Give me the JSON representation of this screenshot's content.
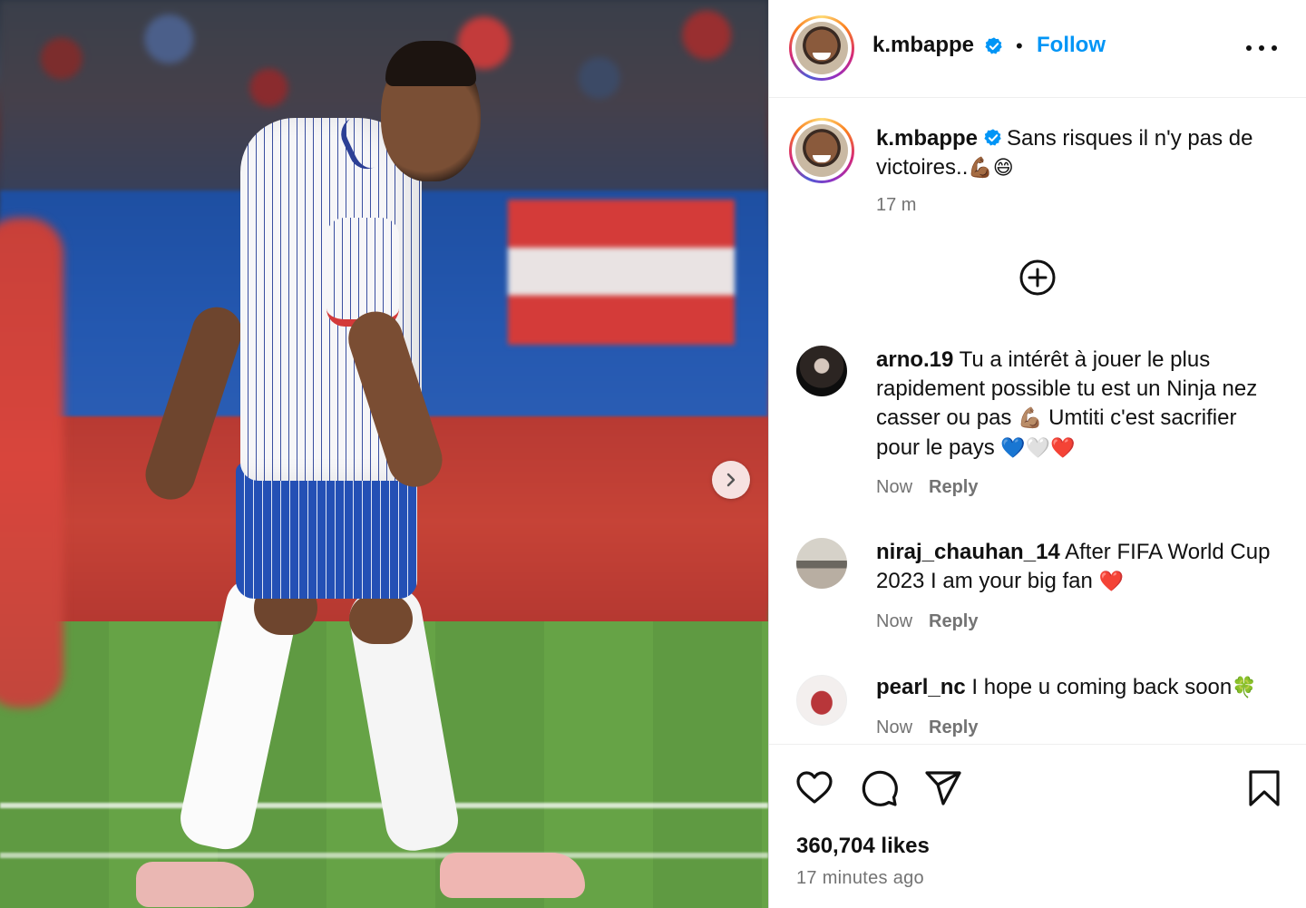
{
  "post": {
    "username": "k.mbappe",
    "follow_label": "Follow",
    "separator": "•",
    "caption_username": "k.mbappe",
    "caption_text": "Sans risques il n'y pas de victoires..",
    "caption_emoji": "💪🏾😄",
    "caption_time": "17 m",
    "likes": "360,704 likes",
    "posted_ago": "17 minutes ago"
  },
  "comments": [
    {
      "username": "arno.19",
      "text_a": "Tu a intérêt à jouer le plus rapidement possible tu est un Ninja nez casser ou pas ",
      "emoji_a": "💪🏽",
      "text_b": " Umtiti c'est sacrifier pour le pays ",
      "emoji_b1": "💙",
      "emoji_b2": "🤍",
      "emoji_b3": "❤️",
      "time": "Now",
      "reply": "Reply"
    },
    {
      "username": "niraj_chauhan_14",
      "text_a": "After FIFA World Cup 2023 I am your big fan ",
      "emoji_a": "❤️",
      "time": "Now",
      "reply": "Reply"
    },
    {
      "username": "pearl_nc",
      "text_a": "I hope u coming back soon",
      "emoji_a": "🍀",
      "time": "Now",
      "reply": "Reply"
    }
  ],
  "icons": {
    "like": "heart-outline-icon",
    "comment": "speech-bubble-icon",
    "share": "paper-plane-icon",
    "save": "bookmark-icon",
    "more": "more-horizontal-icon",
    "add": "plus-circle-icon",
    "next": "chevron-right-icon",
    "verified": "verified-badge-icon"
  },
  "colors": {
    "accent": "#0095f6",
    "verified": "#0095f6",
    "muted": "#737373"
  }
}
